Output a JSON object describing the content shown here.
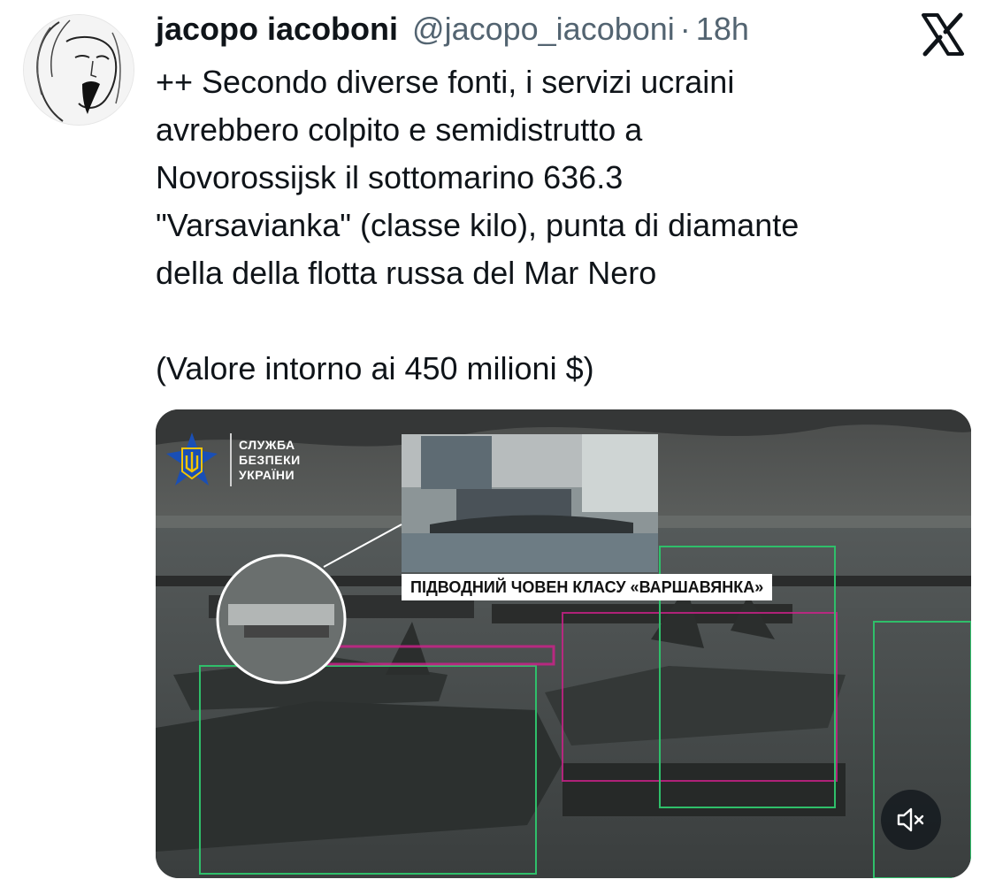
{
  "author": {
    "name": "jacopo iacoboni",
    "handle": "@jacopo_iacoboni",
    "separator": "·",
    "time": "18h"
  },
  "platform_icon": "x-logo-icon",
  "tweet": {
    "lines": [
      "++ Secondo diverse fonti, i servizi ucraini",
      "avrebbero colpito e semidistrutto a",
      "Novorossijsk il sottomarino 636.3",
      "\"Varsavianka\" (classe kilo), punta di diamante",
      "della della flotta russa del Mar Nero"
    ],
    "value_line": "(Valore intorno ai 450 milioni $)"
  },
  "media": {
    "logo_lines": [
      "СЛУЖБА",
      "БЕЗПЕКИ",
      "УКРАЇНИ"
    ],
    "caption": "ПІДВОДНИЙ ЧОВЕН КЛАСУ «ВАРШАВЯНКА»",
    "mute_icon": "speaker-muted-icon"
  },
  "colors": {
    "text": "#0f1419",
    "secondary": "#536471",
    "emblem_blue": "#1a4fb5",
    "emblem_gold": "#f2c400",
    "overlay_green": "#2fbf6a",
    "overlay_magenta": "#d21f8c"
  }
}
